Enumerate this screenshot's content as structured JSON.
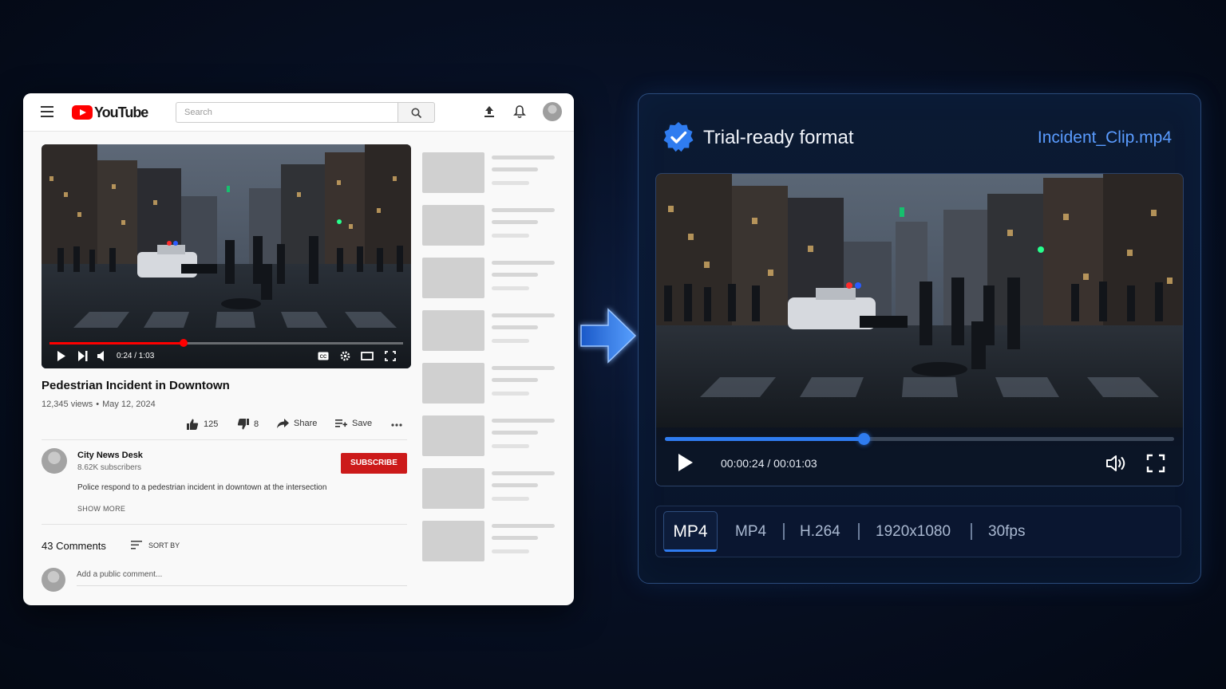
{
  "youtube": {
    "logo_text": "YouTube",
    "search_placeholder": "Search",
    "player": {
      "current_time": "0:24",
      "duration": "1:03",
      "time_display": "0:24 / 1:03",
      "progress_fraction": 0.38
    },
    "video": {
      "title": "Pedestrian Incident in Downtown",
      "views": "12,345 views",
      "date": "May 12, 2024"
    },
    "actions": {
      "likes": "125",
      "dislikes": "8",
      "share": "Share",
      "save": "Save"
    },
    "channel": {
      "name": "City News Desk",
      "subscribers": "8.62K subscribers",
      "subscribe_label": "SUBSCRIBE"
    },
    "description": "Police respond to a pedestrian incident in downtown at the intersection",
    "show_more": "SHOW MORE",
    "comments": {
      "count": "43 Comments",
      "sort_by": "SORT BY",
      "placeholder": "Add a public comment..."
    },
    "related_count": 8
  },
  "export": {
    "title": "Trial-ready format",
    "file_name": "Incident_Clip.mp4",
    "player": {
      "time_display": "00:00:24 / 00:01:03",
      "progress_fraction": 0.39
    },
    "format_selected": "MP4",
    "format_details": [
      "MP4",
      "H.264",
      "1920x1080",
      "30fps"
    ],
    "accent_color": "#2f7cf0"
  }
}
